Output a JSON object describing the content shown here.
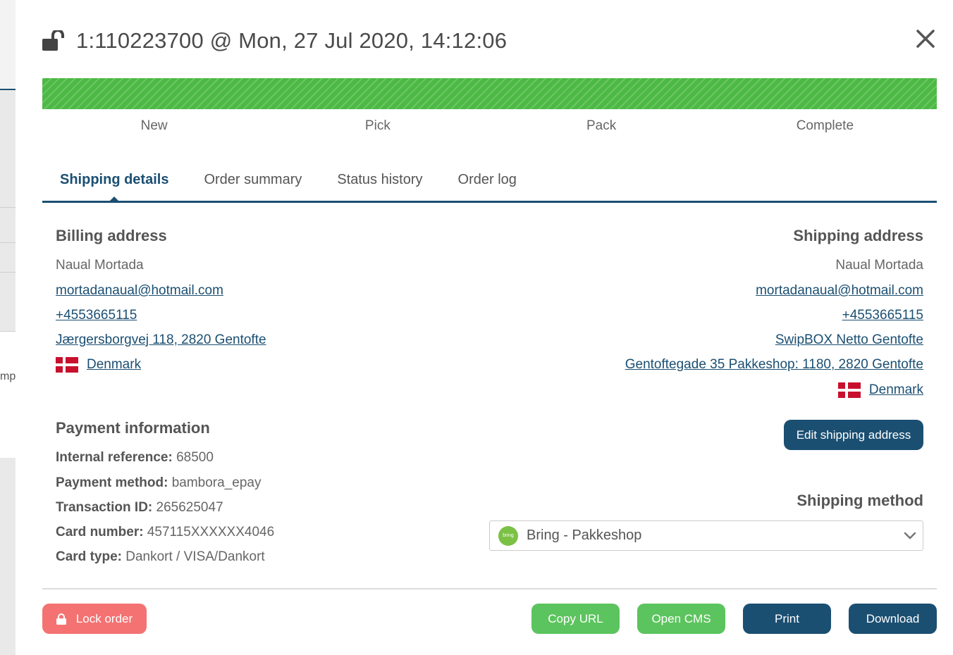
{
  "background": {
    "partial_text": "mp"
  },
  "header": {
    "title": "1:110223700 @ Mon, 27 Jul 2020, 14:12:06",
    "lock_icon": "unlocked-padlock-icon",
    "close_icon": "close-x-icon"
  },
  "progress": {
    "fraction_complete": 1.0,
    "color": "#4cb944",
    "steps": [
      "New",
      "Pick",
      "Pack",
      "Complete"
    ]
  },
  "tabs": [
    {
      "label": "Shipping details",
      "active": true
    },
    {
      "label": "Order summary",
      "active": false
    },
    {
      "label": "Status history",
      "active": false
    },
    {
      "label": "Order log",
      "active": false
    }
  ],
  "billing": {
    "title": "Billing address",
    "name": "Naual Mortada",
    "email": "mortadanaual@hotmail.com",
    "phone": "+4553665115",
    "address": "Jærgersborgvej 118, 2820 Gentofte",
    "country": "Denmark"
  },
  "shipping": {
    "title": "Shipping address",
    "name": "Naual Mortada",
    "email": "mortadanaual@hotmail.com",
    "phone": "+4553665115",
    "pickup_point": "SwipBOX Netto Gentofte",
    "address": "Gentoftegade 35 Pakkeshop: 1180, 2820 Gentofte",
    "country": "Denmark",
    "edit_button": "Edit shipping address"
  },
  "payment": {
    "title": "Payment information",
    "rows": [
      {
        "label": "Internal reference:",
        "value": " 68500"
      },
      {
        "label": "Payment method:",
        "value": " bambora_epay"
      },
      {
        "label": "Transaction ID:",
        "value": " 265625047"
      },
      {
        "label": "Card number:",
        "value": " 457115XXXXXX4046"
      },
      {
        "label": "Card type:",
        "value": " Dankort / VISA/Dankort"
      }
    ]
  },
  "shipping_method": {
    "title": "Shipping method",
    "selected": "Bring - Pakkeshop",
    "logo_text": "bring"
  },
  "footer": {
    "lock_order": "Lock order",
    "copy_url": "Copy URL",
    "open_cms": "Open CMS",
    "print": "Print",
    "download": "Download"
  },
  "colors": {
    "primary": "#1b4f72",
    "green": "#5cc45e",
    "red": "#f47272"
  }
}
